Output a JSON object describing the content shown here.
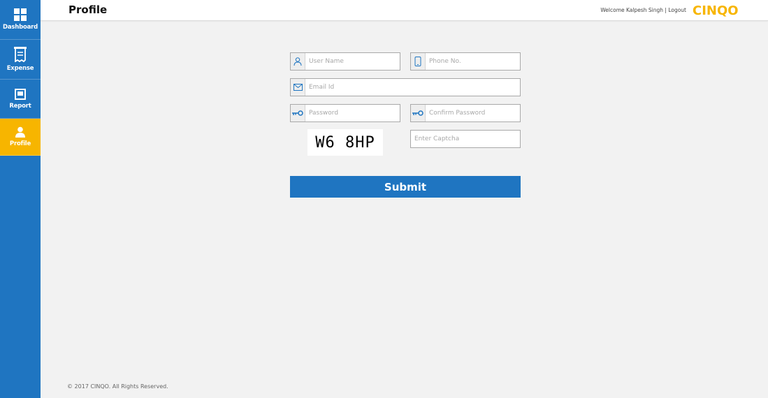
{
  "sidebar": {
    "items": [
      {
        "label": "Dashboard",
        "icon": "dashboard-icon",
        "active": false
      },
      {
        "label": "Expense",
        "icon": "receipt-icon",
        "active": false
      },
      {
        "label": "Report",
        "icon": "report-icon",
        "active": false
      },
      {
        "label": "Profile",
        "icon": "user-icon",
        "active": true
      }
    ]
  },
  "header": {
    "title": "Profile",
    "welcome_text": "Welcome Kalpesh Singh |",
    "logout_label": "Logout",
    "logo_text": "CINQO"
  },
  "form": {
    "username_placeholder": "User Name",
    "phone_placeholder": "Phone No.",
    "email_placeholder": "Email Id",
    "password_placeholder": "Password",
    "confirm_password_placeholder": "Confirm Password",
    "captcha_text": "W6 8HP",
    "captcha_placeholder": "Enter Captcha",
    "submit_label": "Submit"
  },
  "footer": {
    "copyright": "© 2017 CINQO. All Rights Reserved."
  },
  "colors": {
    "primary": "#1f75c1",
    "active_nav": "#f7b500",
    "background": "#f2f2f2"
  }
}
